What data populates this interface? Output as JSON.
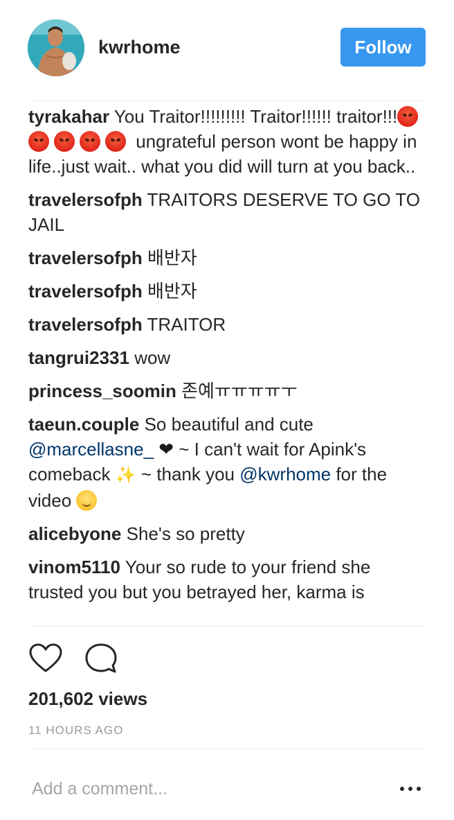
{
  "header": {
    "username": "kwrhome",
    "follow_label": "Follow"
  },
  "comments": [
    {
      "author": "tyrakahar",
      "text_1": "You Traitor!!!!!!!!! Traitor!!!!!! traitor!!!",
      "emojis": [
        "angry-face",
        "angry-face",
        "angry-face",
        "angry-face",
        "angry-face"
      ],
      "text_2": " ungrateful person wont be happy in life..just wait.. what you did will turn at you back.."
    },
    {
      "author": "travelersofph",
      "text": "TRAITORS DESERVE TO GO TO JAIL"
    },
    {
      "author": "travelersofph",
      "text": "배반자"
    },
    {
      "author": "travelersofph",
      "text": "배반자"
    },
    {
      "author": "travelersofph",
      "text": "TRAITOR"
    },
    {
      "author": "tangrui2331",
      "text": "wow"
    },
    {
      "author": "princess_soomin",
      "text": "존예ㅠㅠㅠㅠㅜ"
    },
    {
      "author": "taeun.couple",
      "text_1": "So beautiful and cute ",
      "mention_1": "@marcellasne_",
      "heart": " ❤",
      "text_2": " ~ I can't wait for Apink's comeback ",
      "sparkle": "✨",
      "text_3": "  ~ thank you ",
      "mention_2": "@kwrhome",
      "text_4": " for the video ",
      "emoji": "smiling-face"
    },
    {
      "author": "alicebyone",
      "text": "She's so pretty"
    },
    {
      "author": "vinom5110",
      "text": "Your so rude to your friend she trusted you but you betrayed her, karma is"
    }
  ],
  "actions": {
    "like_icon": "heart-outline-icon",
    "comment_icon": "comment-bubble-icon"
  },
  "stats": {
    "views": "201,602 views",
    "time_ago": "11 HOURS AGO"
  },
  "compose": {
    "placeholder": "Add a comment...",
    "more_icon": "more-options-icon"
  },
  "colors": {
    "follow_button": "#3897f0",
    "mention": "#003569",
    "text": "#262626",
    "muted": "#999999"
  }
}
